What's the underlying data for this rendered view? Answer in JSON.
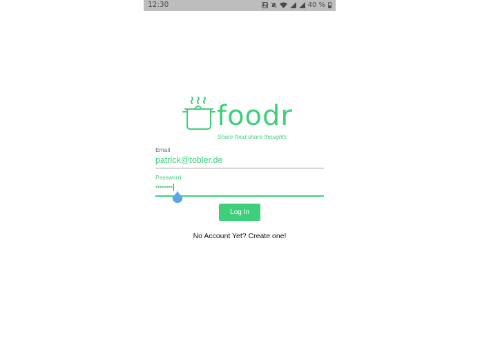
{
  "status_bar": {
    "time": "12:30",
    "battery": "40 %"
  },
  "logo": {
    "wordmark": "foodr",
    "tagline": "Share food share thoughts",
    "color": "#3ecf7a"
  },
  "form": {
    "email": {
      "label": "Email",
      "value": "patrick@tobler.de"
    },
    "password": {
      "label": "Password",
      "masked_value": "••••••••"
    },
    "login_label": "Log In",
    "signup_text": "No Account Yet? Create one!"
  },
  "colors": {
    "accent": "#3ecf7a",
    "status_bar": "#bdbdbd",
    "cursor_handle": "#5ba4e6"
  },
  "icons": {
    "status": [
      "nfc-icon",
      "mute-bell-icon",
      "wifi-icon",
      "signal-icon",
      "signal-icon",
      "battery-icon"
    ],
    "logo": "cooking-pot-icon"
  }
}
